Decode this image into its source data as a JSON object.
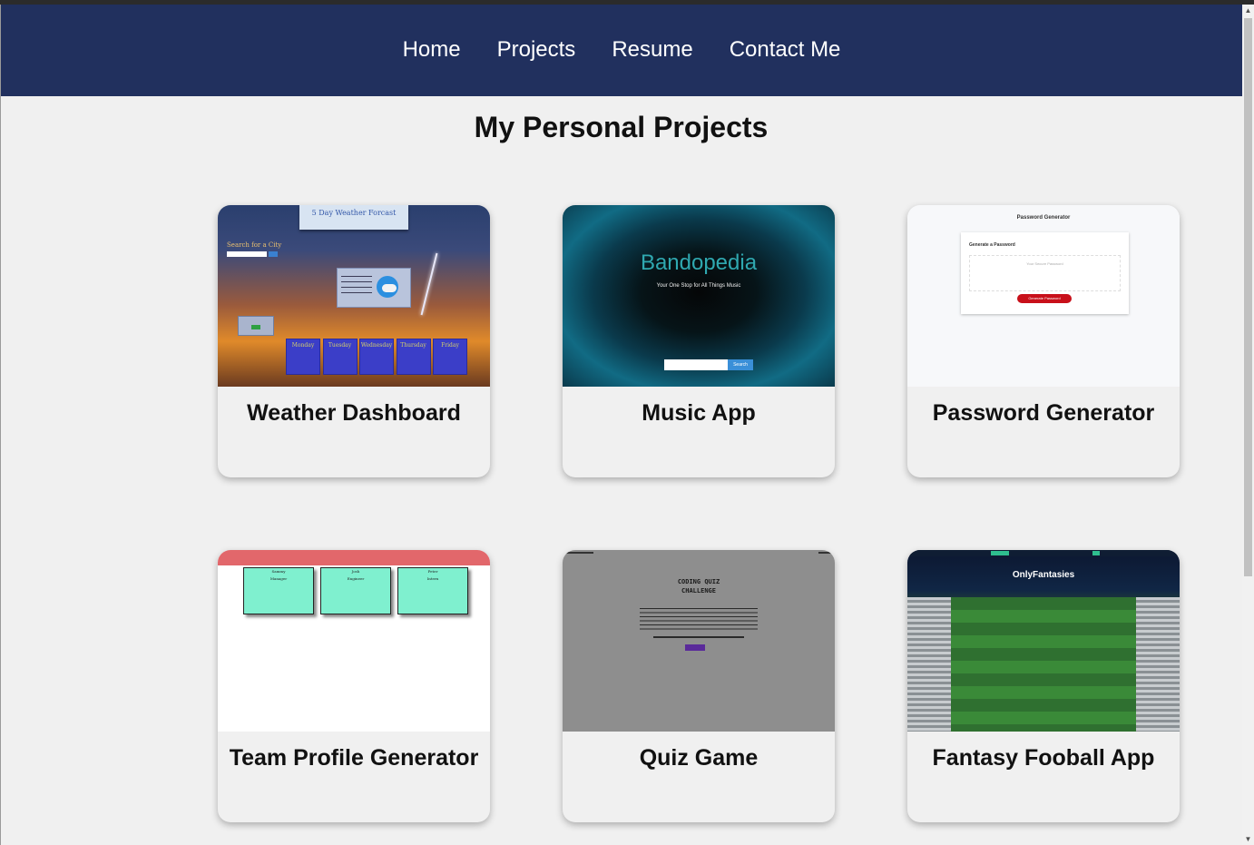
{
  "nav": {
    "items": [
      {
        "label": "Home"
      },
      {
        "label": "Projects"
      },
      {
        "label": "Resume"
      },
      {
        "label": "Contact Me"
      }
    ]
  },
  "main": {
    "heading": "My Personal Projects",
    "projects": [
      {
        "title": "Weather Dashboard",
        "thumbnail": {
          "banner": "5 Day Weather Forcast",
          "search_label": "Search for a City",
          "days": [
            "Monday",
            "Tuesday",
            "Wednesday",
            "Thursday",
            "Friday"
          ]
        }
      },
      {
        "title": "Music App",
        "thumbnail": {
          "app_name": "Bandopedia",
          "tagline": "Your One Stop for All Things Music",
          "search_button": "Search"
        }
      },
      {
        "title": "Password Generator",
        "thumbnail": {
          "header": "Password Generator",
          "card_title": "Generate a Password",
          "placeholder": "Your Secure Password",
          "button": "Generate Password"
        }
      },
      {
        "title": "Team Profile Generator",
        "thumbnail": {
          "members": [
            {
              "name": "Sammy",
              "role": "Manager"
            },
            {
              "name": "Josh",
              "role": "Engineer"
            },
            {
              "name": "Peter",
              "role": "Intern"
            }
          ]
        }
      },
      {
        "title": "Quiz Game",
        "thumbnail": {
          "heading_line1": "CODING QUIZ",
          "heading_line2": "CHALLENGE"
        }
      },
      {
        "title": "Fantasy Fooball App",
        "thumbnail": {
          "app_name": "OnlyFantasies"
        }
      }
    ]
  },
  "colors": {
    "nav_background": "#21305e",
    "page_background": "#f0f0f0"
  }
}
